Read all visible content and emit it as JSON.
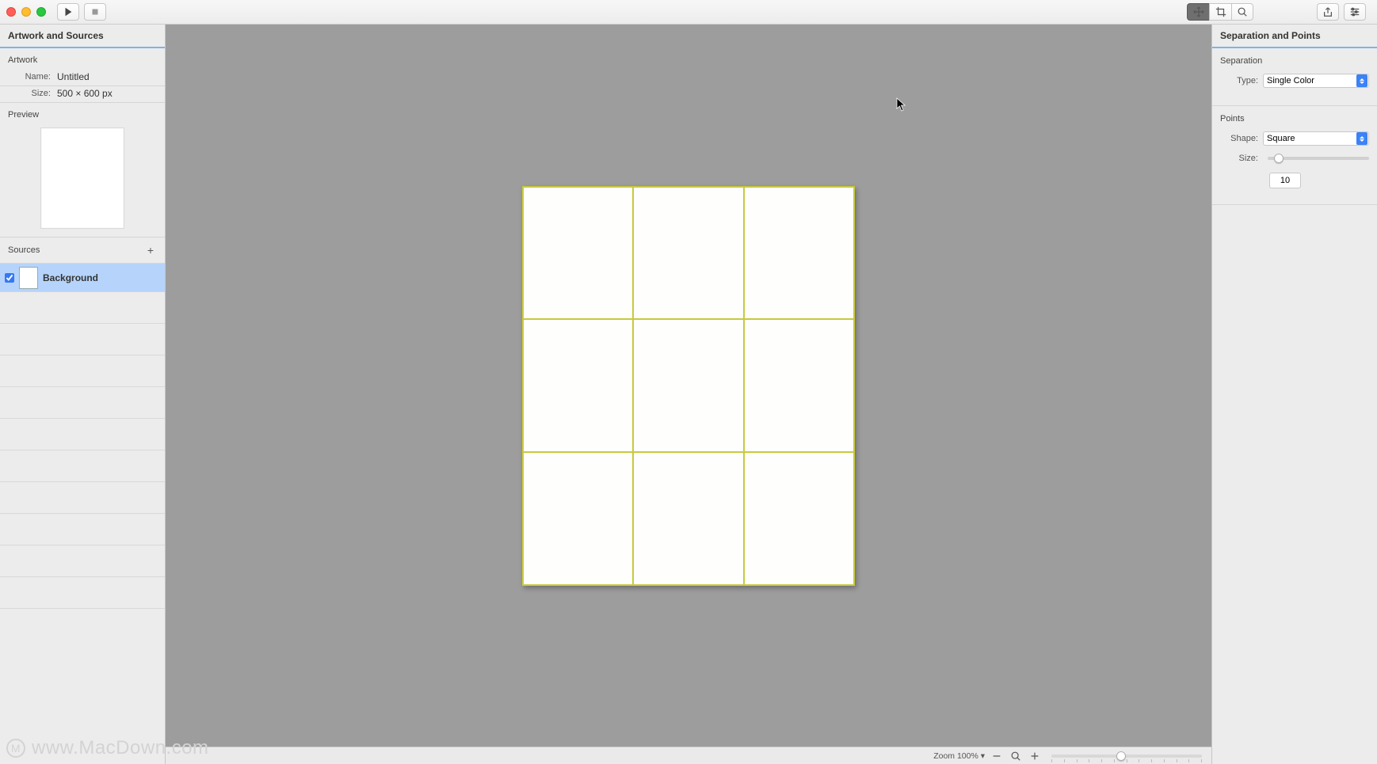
{
  "leftPanel": {
    "title": "Artwork and Sources",
    "artwork": {
      "section": "Artwork",
      "nameLabel": "Name:",
      "nameValue": "Untitled",
      "sizeLabel": "Size:",
      "sizeValue": "500 × 600 px",
      "previewLabel": "Preview"
    },
    "sources": {
      "section": "Sources",
      "items": [
        {
          "name": "Background",
          "checked": true
        }
      ]
    }
  },
  "rightPanel": {
    "title": "Separation and Points",
    "separation": {
      "section": "Separation",
      "typeLabel": "Type:",
      "typeValue": "Single Color"
    },
    "points": {
      "section": "Points",
      "shapeLabel": "Shape:",
      "shapeValue": "Square",
      "sizeLabel": "Size:",
      "sizeValue": "10",
      "sizeSliderPercent": 6
    }
  },
  "zoomBar": {
    "label": "Zoom 100% ▾",
    "sliderPercent": 43
  },
  "watermark": "www.MacDown.com"
}
